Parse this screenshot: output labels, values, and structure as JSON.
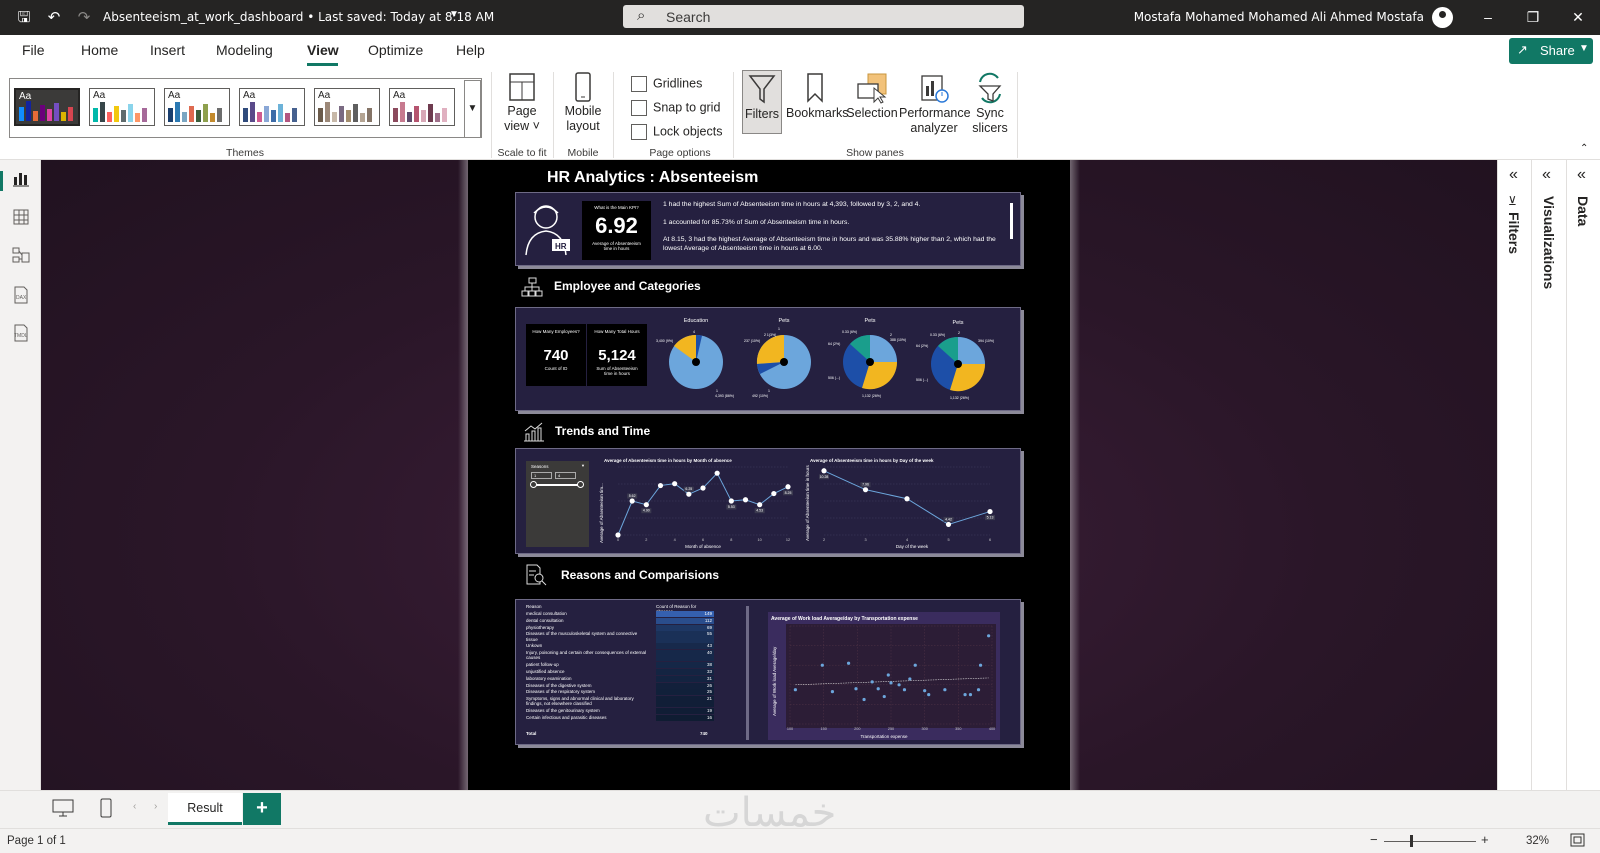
{
  "titlebar": {
    "doc_title": "Absenteeism_at_work_dashboard • Last saved: Today at 8:18 AM",
    "search_placeholder": "Search",
    "user_name": "Mostafa Mohamed Mohamed Ali Ahmed Mostafa"
  },
  "menu": {
    "items": [
      "File",
      "Home",
      "Insert",
      "Modeling",
      "View",
      "Optimize",
      "Help"
    ],
    "active": "View",
    "share_label": "Share"
  },
  "ribbon": {
    "themes_label": "Themes",
    "theme_tile_text": "Aa",
    "page_view": [
      "Page",
      "view"
    ],
    "scale_to_fit_label": "Scale to fit",
    "mobile_layout": [
      "Mobile",
      "layout"
    ],
    "mobile_label": "Mobile",
    "checkboxes": [
      "Gridlines",
      "Snap to grid",
      "Lock objects"
    ],
    "page_options_label": "Page options",
    "filters": "Filters",
    "bookmarks": "Bookmarks",
    "selection": "Selection",
    "performance": [
      "Performance",
      "analyzer"
    ],
    "sync_slicers": [
      "Sync",
      "slicers"
    ],
    "show_panes_label": "Show panes"
  },
  "panes": {
    "filters": "Filters",
    "visualizations": "Visualizations",
    "data": "Data"
  },
  "report": {
    "title": "HR Analytics : Absenteeism",
    "kpi": {
      "question": "What is the Main KPI?",
      "value": "6.92",
      "caption": "Average of Absenteeism time in hours",
      "insights": [
        "1 had the highest Sum of Absenteeism time in hours at 4,393, followed by 3, 2, and 4.",
        "1 accounted for 85.73% of Sum of Absenteeism time in hours.",
        "At 8.15, 3 had the highest Average of Absenteeism time in hours and was 35.88% higher than 2, which had the lowest Average of Absenteeism time in hours at 6.00."
      ]
    },
    "section1": "Employee and Categories",
    "employees": {
      "q1": "How Many Employees?",
      "v1": "740",
      "c1": "Count of ID",
      "q2": "How Many Total Hours",
      "v2": "5,124",
      "c2": "Sum of Absenteeism time in hours"
    },
    "pies": [
      {
        "title": "Education",
        "labels": [
          "4",
          "3,400 (9%)",
          "1",
          "4,393 (86%)"
        ]
      },
      {
        "title": "Pets",
        "labels": [
          "1",
          "2 1(3%)",
          "237 (10%)",
          "1",
          "492 (10%)"
        ]
      },
      {
        "title": "Pets",
        "labels": [
          "0.33 (6%)",
          "2",
          "388 (10%)",
          "64 (2%)",
          "506 (...)",
          "1,132 (26%)"
        ]
      },
      {
        "title": "Pets",
        "labels": [
          "2",
          "0.33 (6%)",
          "394 (10%)",
          "64 (2%)",
          "506 (...)",
          "1,132 (26%)"
        ]
      }
    ],
    "section2": "Trends and Time",
    "slicer": {
      "title": "Seasons",
      "from": "1",
      "to": "4"
    },
    "month_chart": {
      "title": "Average of Absenteeism time in hours by Month of absence",
      "xlabel": "Month of absence",
      "ylabel": "Average of Absenteeism tim..."
    },
    "day_chart": {
      "title": "Average of Absenteeism time in hours by Day of the week",
      "xlabel": "Day of the week",
      "ylabel": "Average of Absenteeism time in hours"
    },
    "section3": "Reasons and Comparisions",
    "reason_table": {
      "col1": "Reason",
      "col2": "Count of Reason for absence",
      "rows": [
        [
          "medical consultation",
          "149"
        ],
        [
          "dental consultation",
          "112"
        ],
        [
          "physiotherapy",
          "69"
        ],
        [
          "Diseases of the musculoskeletal system and connective tissue",
          "55"
        ],
        [
          "Unkown",
          "43"
        ],
        [
          "Injury, poisoning and certain other consequences of external causes",
          "40"
        ],
        [
          "patient follow-up",
          "38"
        ],
        [
          "unjustified absence",
          "33"
        ],
        [
          "laboratory examination",
          "31"
        ],
        [
          "Diseases of the digestive system",
          "26"
        ],
        [
          "Diseases of the respiratory system",
          "25"
        ],
        [
          "Symptoms, signs and abnormal clinical and laboratory findings, not elsewhere classified",
          "21"
        ],
        [
          "Diseases of the genitourinary system",
          "19"
        ],
        [
          "Certain infectious and parasitic diseases",
          "16"
        ]
      ],
      "total_label": "Total",
      "total_value": "740"
    },
    "scatter": {
      "title": "Average of Work load Average/day by Transportation expense",
      "xlabel": "Transportation expense",
      "ylabel": "Average of Work load Average/day"
    }
  },
  "chart_data": [
    {
      "type": "line",
      "title": "Average of Absenteeism time in hours by Month of absence",
      "xlabel": "Month of absence",
      "ylabel": "Average of Absenteeism tim...",
      "x": [
        0,
        1,
        2,
        3,
        4,
        5,
        6,
        7,
        8,
        9,
        10,
        11,
        12
      ],
      "values": [
        0.0,
        5.5,
        4.9,
        8.0,
        8.3,
        6.6,
        7.6,
        10.0,
        5.5,
        5.7,
        4.9,
        6.7,
        7.8
      ],
      "value_labels": [
        "",
        "5.62",
        "4.90",
        "",
        "",
        "6.25",
        "",
        "",
        "5.53",
        "",
        "4.53",
        "",
        "8.25"
      ],
      "ylim": [
        0,
        11
      ]
    },
    {
      "type": "line",
      "title": "Average of Absenteeism time in hours by Day of the week",
      "xlabel": "Day of the week",
      "ylabel": "Average of Absenteeism time in hours",
      "x": [
        2,
        3,
        4,
        5,
        6
      ],
      "values": [
        10.5,
        8.0,
        6.8,
        3.4,
        5.1
      ],
      "value_labels": [
        "10.28",
        "7.96",
        "",
        "4.42",
        "5.13"
      ],
      "ylim": [
        2,
        11
      ]
    },
    {
      "type": "scatter",
      "title": "Average of Work load Average/day by Transportation expense",
      "xlabel": "Transportation expense",
      "ylabel": "Average of Work load Average/day",
      "x_ticks": [
        "100",
        "150",
        "200",
        "250",
        "300",
        "350",
        "400"
      ],
      "xlim": [
        100,
        400
      ],
      "points": [
        [
          108,
          0.35
        ],
        [
          148,
          0.6
        ],
        [
          163,
          0.33
        ],
        [
          187,
          0.62
        ],
        [
          198,
          0.36
        ],
        [
          210,
          0.25
        ],
        [
          222,
          0.43
        ],
        [
          231,
          0.36
        ],
        [
          240,
          0.28
        ],
        [
          246,
          0.5
        ],
        [
          250,
          0.42
        ],
        [
          262,
          0.4
        ],
        [
          270,
          0.35
        ],
        [
          278,
          0.46
        ],
        [
          286,
          0.6
        ],
        [
          300,
          0.34
        ],
        [
          306,
          0.3
        ],
        [
          330,
          0.35
        ],
        [
          360,
          0.3
        ],
        [
          368,
          0.3
        ],
        [
          380,
          0.35
        ],
        [
          383,
          0.6
        ],
        [
          395,
          0.9
        ]
      ],
      "trend": [
        [
          108,
          0.4
        ],
        [
          395,
          0.47
        ]
      ]
    }
  ]
}
